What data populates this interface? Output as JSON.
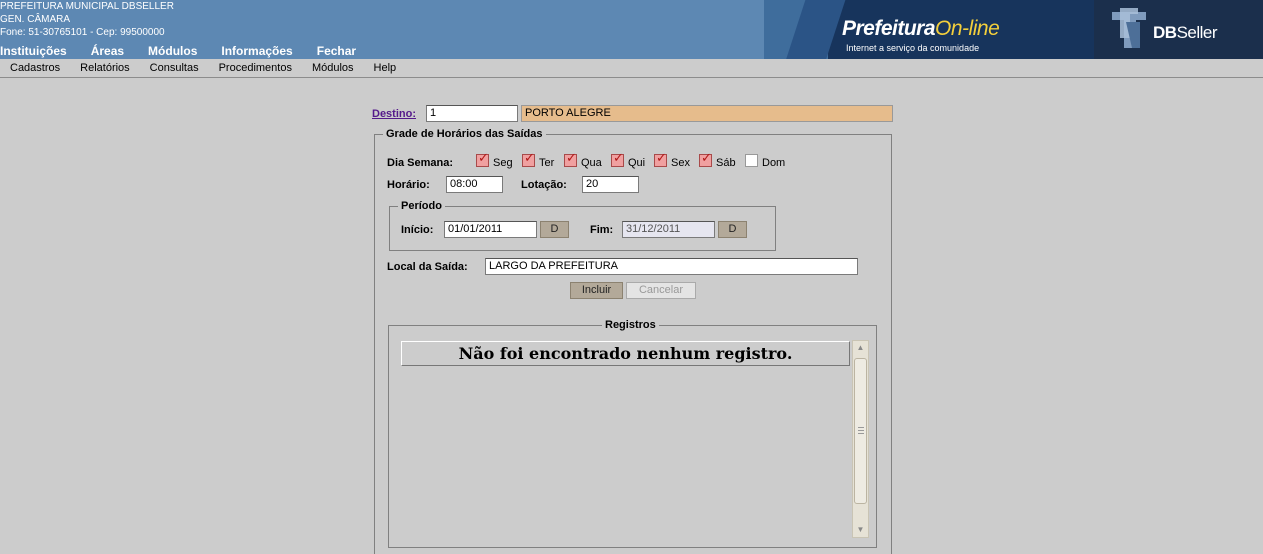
{
  "header": {
    "org_name": "PREFEITURA MUNICIPAL DBSELLER",
    "city": "GEN. CÂMARA",
    "contact": "Fone: 51-30765101  -  Cep: 99500000",
    "nav": [
      "Instituições",
      "Áreas",
      "Módulos",
      "Informações",
      "Fechar"
    ],
    "brand_title_bold": "Prefeitura",
    "brand_title_light": "On-line",
    "brand_subtitle": "Internet a serviço da comunidade",
    "dbseller_bold": "DB",
    "dbseller_light": "Seller",
    "colors": {
      "header_bg": "#5d88b3",
      "brand_bg": "#17345c",
      "accent_yellow": "#f3cf3c"
    }
  },
  "menubar": [
    "Cadastros",
    "Relatórios",
    "Consultas",
    "Procedimentos",
    "Módulos",
    "Help"
  ],
  "form": {
    "destino_label": "Destino:",
    "destino_code": "1",
    "destino_name": "PORTO ALEGRE",
    "grade_legend": "Grade de Horários das Saídas",
    "dia_semana_label": "Dia Semana:",
    "days": [
      {
        "label": "Seg",
        "checked": true
      },
      {
        "label": "Ter",
        "checked": true
      },
      {
        "label": "Qua",
        "checked": true
      },
      {
        "label": "Qui",
        "checked": true
      },
      {
        "label": "Sex",
        "checked": true
      },
      {
        "label": "Sáb",
        "checked": true
      },
      {
        "label": "Dom",
        "checked": false
      }
    ],
    "horario_label": "Horário:",
    "horario_value": "08:00",
    "lotacao_label": "Lotação:",
    "lotacao_value": "20",
    "periodo_legend": "Período",
    "inicio_label": "Início:",
    "inicio_value": "01/01/2011",
    "fim_label": "Fim:",
    "fim_value": "31/12/2011",
    "date_button": "D",
    "local_label": "Local da Saída:",
    "local_value": "LARGO DA PREFEITURA",
    "incluir_label": "Incluir",
    "cancelar_label": "Cancelar"
  },
  "registros": {
    "legend": "Registros",
    "empty_message": "Não foi encontrado nenhum registro."
  }
}
